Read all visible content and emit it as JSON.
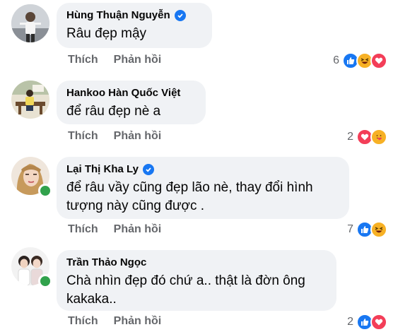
{
  "actions": {
    "like": "Thích",
    "reply": "Phản hồi"
  },
  "comments": [
    {
      "author": "Hùng Thuận Nguyễn",
      "text": "Râu đẹp mậy",
      "verified": true,
      "online": false,
      "reaction_count": "6",
      "reactions": [
        "like-icon",
        "haha-icon",
        "love-icon"
      ]
    },
    {
      "author": "Hankoo Hàn Quốc Việt",
      "text": "để râu đẹp nè a",
      "verified": false,
      "online": false,
      "reaction_count": "2",
      "reactions": [
        "love-icon",
        "care-icon"
      ]
    },
    {
      "author": "Lại Thị Kha Ly",
      "text": "để râu vầy cũng đẹp lão nè, thay đổi hình tượng này cũng được .",
      "verified": true,
      "online": true,
      "reaction_count": "7",
      "reactions": [
        "like-icon",
        "haha-icon"
      ]
    },
    {
      "author": "Trần Thảo Ngọc",
      "text": "Chà nhìn đẹp đó chứ a.. thật là đờn ông kakaka..",
      "verified": false,
      "online": true,
      "reaction_count": "2",
      "reactions": [
        "like-icon",
        "love-icon"
      ]
    }
  ]
}
